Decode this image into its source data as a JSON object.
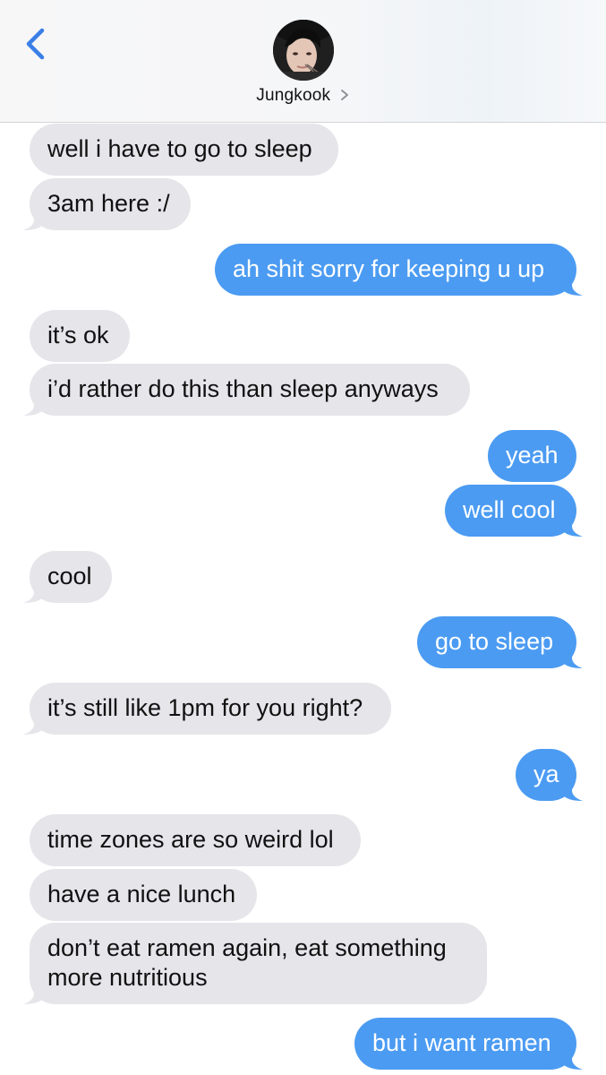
{
  "header": {
    "back_icon": "chevron-left-icon",
    "contact_name": "Jungkook",
    "contact_chevron": "chevron-right-icon",
    "accent_color": "#3a7fe6"
  },
  "colors": {
    "incoming_bubble": "#e5e5ea",
    "outgoing_bubble": "#4b9bf2"
  },
  "messages": [
    {
      "dir": "in",
      "text": "well i have to go to sleep"
    },
    {
      "dir": "in",
      "text": "3am here :/"
    },
    {
      "dir": "out",
      "text": "ah shit sorry for keeping u up"
    },
    {
      "dir": "in",
      "text": "it’s ok"
    },
    {
      "dir": "in",
      "text": "i’d rather do this than sleep anyways"
    },
    {
      "dir": "out",
      "text": "yeah"
    },
    {
      "dir": "out",
      "text": "well cool"
    },
    {
      "dir": "in",
      "text": "cool"
    },
    {
      "dir": "out",
      "text": "go to sleep"
    },
    {
      "dir": "in",
      "text": "it’s still like 1pm for you right?"
    },
    {
      "dir": "out",
      "text": "ya"
    },
    {
      "dir": "in",
      "text": "time zones are so weird lol"
    },
    {
      "dir": "in",
      "text": "have a nice lunch"
    },
    {
      "dir": "in",
      "text_line1": "don’t eat ramen again, eat something",
      "text_line2": "more nutritious"
    },
    {
      "dir": "out",
      "text": "but i want ramen"
    }
  ]
}
